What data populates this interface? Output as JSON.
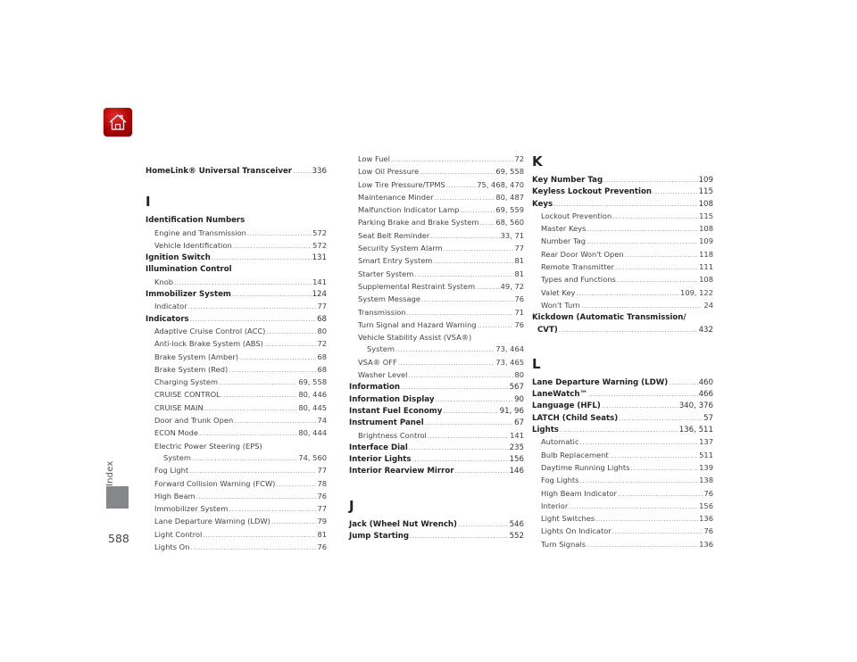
{
  "page": {
    "number": "588",
    "side_tab": "Index",
    "home_icon": "home-icon"
  },
  "column1": {
    "top_entry": {
      "label": "HomeLink® Universal Transceiver",
      "pages": "336"
    },
    "section_I": {
      "letter": "I",
      "entries": [
        {
          "label": "Identification Numbers",
          "pages": "",
          "level": "main"
        },
        {
          "label": "Engine and Transmission",
          "pages": "572",
          "level": "sub"
        },
        {
          "label": "Vehicle Identification",
          "pages": "572",
          "level": "sub"
        },
        {
          "label": "Ignition Switch",
          "pages": "131",
          "level": "main"
        },
        {
          "label": "Illumination Control",
          "pages": "",
          "level": "main"
        },
        {
          "label": "Knob",
          "pages": "141",
          "level": "sub"
        },
        {
          "label": "Immobilizer System",
          "pages": "124",
          "level": "main"
        },
        {
          "label": "Indicator",
          "pages": "77",
          "level": "sub"
        },
        {
          "label": "Indicators",
          "pages": "68",
          "level": "main"
        },
        {
          "label": "Adaptive Cruise Control (ACC)",
          "pages": "80",
          "level": "sub"
        },
        {
          "label": "Anti-lock Brake System (ABS)",
          "pages": "72",
          "level": "sub"
        },
        {
          "label": "Brake System (Amber)",
          "pages": "68",
          "level": "sub"
        },
        {
          "label": "Brake System (Red)",
          "pages": "68",
          "level": "sub"
        },
        {
          "label": "Charging System",
          "pages": "69, 558",
          "level": "sub"
        },
        {
          "label": "CRUISE CONTROL",
          "pages": "80, 446",
          "level": "sub"
        },
        {
          "label": "CRUISE MAIN",
          "pages": "80, 445",
          "level": "sub"
        },
        {
          "label": "Door and Trunk Open",
          "pages": "74",
          "level": "sub"
        },
        {
          "label": "ECON Mode",
          "pages": "80, 444",
          "level": "sub"
        },
        {
          "label": "Electric Power Steering (EPS)",
          "pages": "",
          "level": "sub"
        },
        {
          "label": "System",
          "pages": "74, 560",
          "level": "cont"
        },
        {
          "label": "Fog Light",
          "pages": "77",
          "level": "sub"
        },
        {
          "label": "Forward Collision Warning (FCW)",
          "pages": "78",
          "level": "sub"
        },
        {
          "label": "High Beam",
          "pages": "76",
          "level": "sub"
        },
        {
          "label": "Immobilizer System",
          "pages": "77",
          "level": "sub"
        },
        {
          "label": "Lane Departure Warning (LDW)",
          "pages": "79",
          "level": "sub"
        },
        {
          "label": "Light Control",
          "pages": "81",
          "level": "sub"
        },
        {
          "label": "Lights On",
          "pages": "76",
          "level": "sub"
        }
      ]
    }
  },
  "column2": {
    "entries": [
      {
        "label": "Low Fuel",
        "pages": "72",
        "level": "sub"
      },
      {
        "label": "Low Oil Pressure",
        "pages": "69, 558",
        "level": "sub"
      },
      {
        "label": "Low Tire Pressure/TPMS",
        "pages": "75, 468, 470",
        "level": "sub"
      },
      {
        "label": "Maintenance Minder",
        "pages": "80, 487",
        "level": "sub"
      },
      {
        "label": "Malfunction Indicator Lamp",
        "pages": "69, 559",
        "level": "sub"
      },
      {
        "label": "Parking Brake and Brake System",
        "pages": "68, 560",
        "level": "sub"
      },
      {
        "label": "Seat Belt Reminder",
        "pages": "33, 71",
        "level": "sub"
      },
      {
        "label": "Security System Alarm",
        "pages": "77",
        "level": "sub"
      },
      {
        "label": "Smart Entry System",
        "pages": "81",
        "level": "sub"
      },
      {
        "label": "Starter System",
        "pages": "81",
        "level": "sub"
      },
      {
        "label": "Supplemental Restraint System",
        "pages": "49, 72",
        "level": "sub"
      },
      {
        "label": "System Message",
        "pages": "76",
        "level": "sub"
      },
      {
        "label": "Transmission",
        "pages": "71",
        "level": "sub"
      },
      {
        "label": "Turn Signal and Hazard Warning",
        "pages": "76",
        "level": "sub"
      },
      {
        "label": "Vehicle Stability Assist (VSA®)",
        "pages": "",
        "level": "sub"
      },
      {
        "label": "System",
        "pages": "73, 464",
        "level": "cont"
      },
      {
        "label": "VSA® OFF",
        "pages": "73, 465",
        "level": "sub"
      },
      {
        "label": "Washer Level",
        "pages": "80",
        "level": "sub"
      },
      {
        "label": "Information",
        "pages": "567",
        "level": "main"
      },
      {
        "label": "Information Display",
        "pages": "90",
        "level": "main"
      },
      {
        "label": "Instant Fuel Economy",
        "pages": "91, 96",
        "level": "main"
      },
      {
        "label": "Instrument Panel",
        "pages": "67",
        "level": "main"
      },
      {
        "label": "Brightness Control",
        "pages": "141",
        "level": "sub"
      },
      {
        "label": "Interface Dial",
        "pages": "235",
        "level": "main"
      },
      {
        "label": "Interior Lights",
        "pages": "156",
        "level": "main"
      },
      {
        "label": "Interior Rearview Mirror",
        "pages": "146",
        "level": "main"
      }
    ],
    "section_J": {
      "letter": "J",
      "entries": [
        {
          "label": "Jack (Wheel Nut Wrench)",
          "pages": "546",
          "level": "main"
        },
        {
          "label": "Jump Starting",
          "pages": "552",
          "level": "main"
        }
      ]
    }
  },
  "column3": {
    "section_K": {
      "letter": "K",
      "entries": [
        {
          "label": "Key Number Tag",
          "pages": "109",
          "level": "main"
        },
        {
          "label": "Keyless Lockout Prevention",
          "pages": "115",
          "level": "main"
        },
        {
          "label": "Keys",
          "pages": "108",
          "level": "main"
        },
        {
          "label": "Lockout Prevention",
          "pages": "115",
          "level": "sub"
        },
        {
          "label": "Master Keys",
          "pages": "108",
          "level": "sub"
        },
        {
          "label": "Number Tag",
          "pages": "109",
          "level": "sub"
        },
        {
          "label": "Rear Door Won't Open",
          "pages": "118",
          "level": "sub"
        },
        {
          "label": "Remote Transmitter",
          "pages": "111",
          "level": "sub"
        },
        {
          "label": "Types and Functions",
          "pages": "108",
          "level": "sub"
        },
        {
          "label": "Valet Key",
          "pages": "109, 122",
          "level": "sub"
        },
        {
          "label": "Won't Turn",
          "pages": "24",
          "level": "sub"
        },
        {
          "label": "Kickdown (Automatic Transmission/",
          "pages": "",
          "level": "main"
        },
        {
          "label": "CVT)",
          "pages": "432",
          "level": "main-cont"
        }
      ]
    },
    "section_L": {
      "letter": "L",
      "entries": [
        {
          "label": "Lane Departure Warning (LDW)",
          "pages": "460",
          "level": "main"
        },
        {
          "label": "LaneWatch™",
          "pages": "466",
          "level": "main"
        },
        {
          "label": "Language (HFL)",
          "pages": "340, 376",
          "level": "main"
        },
        {
          "label": "LATCH (Child Seats)",
          "pages": "57",
          "level": "main"
        },
        {
          "label": "Lights",
          "pages": "136, 511",
          "level": "main"
        },
        {
          "label": "Automatic",
          "pages": "137",
          "level": "sub"
        },
        {
          "label": "Bulb Replacement",
          "pages": "511",
          "level": "sub"
        },
        {
          "label": "Daytime Running Lights",
          "pages": "139",
          "level": "sub"
        },
        {
          "label": "Fog Lights",
          "pages": "138",
          "level": "sub"
        },
        {
          "label": "High Beam Indicator",
          "pages": "76",
          "level": "sub"
        },
        {
          "label": "Interior",
          "pages": "156",
          "level": "sub"
        },
        {
          "label": "Light Switches",
          "pages": "136",
          "level": "sub"
        },
        {
          "label": "Lights On Indicator",
          "pages": "76",
          "level": "sub"
        },
        {
          "label": "Turn Signals",
          "pages": "136",
          "level": "sub"
        }
      ]
    }
  }
}
